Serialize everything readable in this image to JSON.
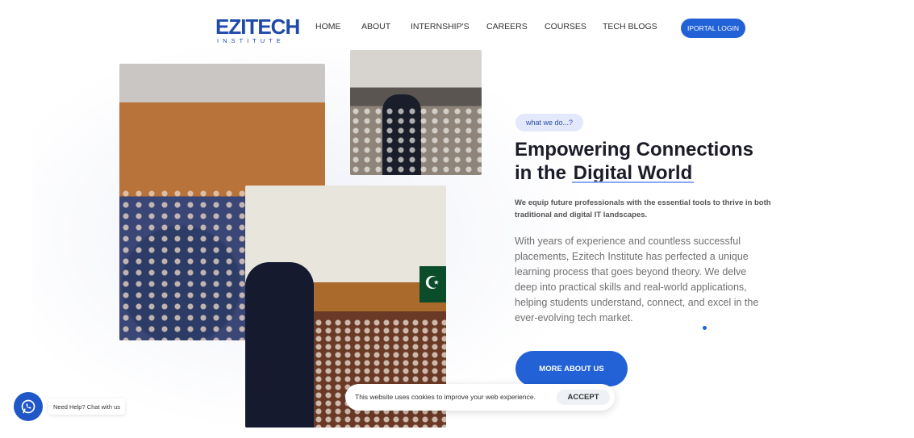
{
  "brand": {
    "logo_main": "EZITECH",
    "logo_sub": "INSTITUTE",
    "primary_color": "#2262d6"
  },
  "nav": {
    "items": [
      {
        "label": "HOME"
      },
      {
        "label": "ABOUT"
      },
      {
        "label": "INTERNSHIP'S"
      },
      {
        "label": "CAREERS"
      },
      {
        "label": "COURSES"
      },
      {
        "label": "TECH BLOGS"
      }
    ],
    "portal_label": "IPORTAL LOGIN"
  },
  "hero": {
    "tag": "what we do...?",
    "headline_part1": "Empowering Connections in the",
    "headline_highlight": "Digital World",
    "subtitle": "We equip future professionals with the essential tools to thrive in both traditional and digital IT landscapes.",
    "body": "With years of experience and countless successful placements, Ezitech Institute has perfected a unique learning process that goes beyond theory. We delve deep into practical skills and real-world applications, helping students understand, connect, and excel in the ever-evolving tech market.",
    "cta_label": "MORE ABOUT US"
  },
  "cookie": {
    "text": "This website uses cookies to improve your web experience.",
    "accept_label": "ACCEPT"
  },
  "whatsapp": {
    "label": "Need Help? Chat with us",
    "icon": "whatsapp-icon"
  }
}
